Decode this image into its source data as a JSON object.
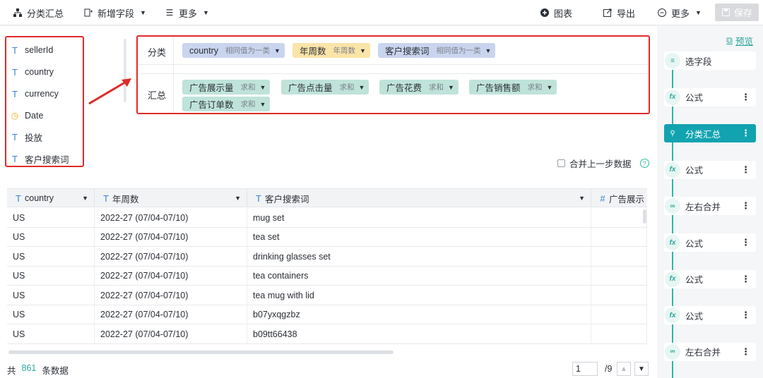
{
  "toolbar": {
    "title": "分类汇总",
    "add_field": "新增字段",
    "more_left": "更多",
    "chart": "图表",
    "export": "导出",
    "more_right": "更多",
    "save": "保存"
  },
  "fields": [
    {
      "type": "text",
      "label": "sellerId"
    },
    {
      "type": "text",
      "label": "country"
    },
    {
      "type": "text",
      "label": "currency"
    },
    {
      "type": "date",
      "label": "Date"
    },
    {
      "type": "text",
      "label": "投放"
    },
    {
      "type": "text",
      "label": "客户搜索词"
    }
  ],
  "config": {
    "group_label": "分类",
    "group_chips": [
      {
        "name": "country",
        "sub": "相同值为一类"
      },
      {
        "name": "年周数",
        "sub": "年周数"
      },
      {
        "name": "客户搜索词",
        "sub": "相同值为一类"
      }
    ],
    "summary_label": "汇总",
    "summary_chips": [
      {
        "name": "广告展示量",
        "sub": "求和"
      },
      {
        "name": "广告点击量",
        "sub": "求和"
      },
      {
        "name": "广告花费",
        "sub": "求和"
      },
      {
        "name": "广告销售额",
        "sub": "求和"
      },
      {
        "name": "广告订单数",
        "sub": "求和"
      }
    ]
  },
  "merge_label": "合并上一步数据",
  "table": {
    "columns": [
      "country",
      "年周数",
      "客户搜索词",
      "广告展示"
    ],
    "rows": [
      [
        "US",
        "2022-27 (07/04-07/10)",
        "mug set",
        ""
      ],
      [
        "US",
        "2022-27 (07/04-07/10)",
        "tea set",
        ""
      ],
      [
        "US",
        "2022-27 (07/04-07/10)",
        "drinking glasses set",
        ""
      ],
      [
        "US",
        "2022-27 (07/04-07/10)",
        "tea containers",
        ""
      ],
      [
        "US",
        "2022-27 (07/04-07/10)",
        "tea mug with lid",
        ""
      ],
      [
        "US",
        "2022-27 (07/04-07/10)",
        "b07yxqgzbz",
        ""
      ],
      [
        "US",
        "2022-27 (07/04-07/10)",
        "b09tt66438",
        ""
      ]
    ]
  },
  "footer": {
    "prefix": "共",
    "count": "861",
    "suffix": "条数据",
    "page": "1",
    "total_pages": "/9"
  },
  "steps_panel": {
    "preview": "预览",
    "steps": [
      {
        "label": "选字段",
        "icon": "select-fields-icon",
        "active": false,
        "more": false
      },
      {
        "label": "公式",
        "icon": "fx-icon",
        "active": false,
        "more": true
      },
      {
        "label": "分类汇总",
        "icon": "group-summary-icon",
        "active": true,
        "more": true
      },
      {
        "label": "公式",
        "icon": "fx-icon",
        "active": false,
        "more": true
      },
      {
        "label": "左右合并",
        "icon": "join-icon",
        "active": false,
        "more": true
      },
      {
        "label": "公式",
        "icon": "fx-icon",
        "active": false,
        "more": true
      },
      {
        "label": "公式",
        "icon": "fx-icon",
        "active": false,
        "more": true
      },
      {
        "label": "公式",
        "icon": "fx-icon",
        "active": false,
        "more": true
      },
      {
        "label": "左右合并",
        "icon": "join-icon",
        "active": false,
        "more": true
      }
    ]
  },
  "colors": {
    "accent": "#2aa89a",
    "active_step": "#12a3b0",
    "highlight_border": "#e02a2a"
  }
}
